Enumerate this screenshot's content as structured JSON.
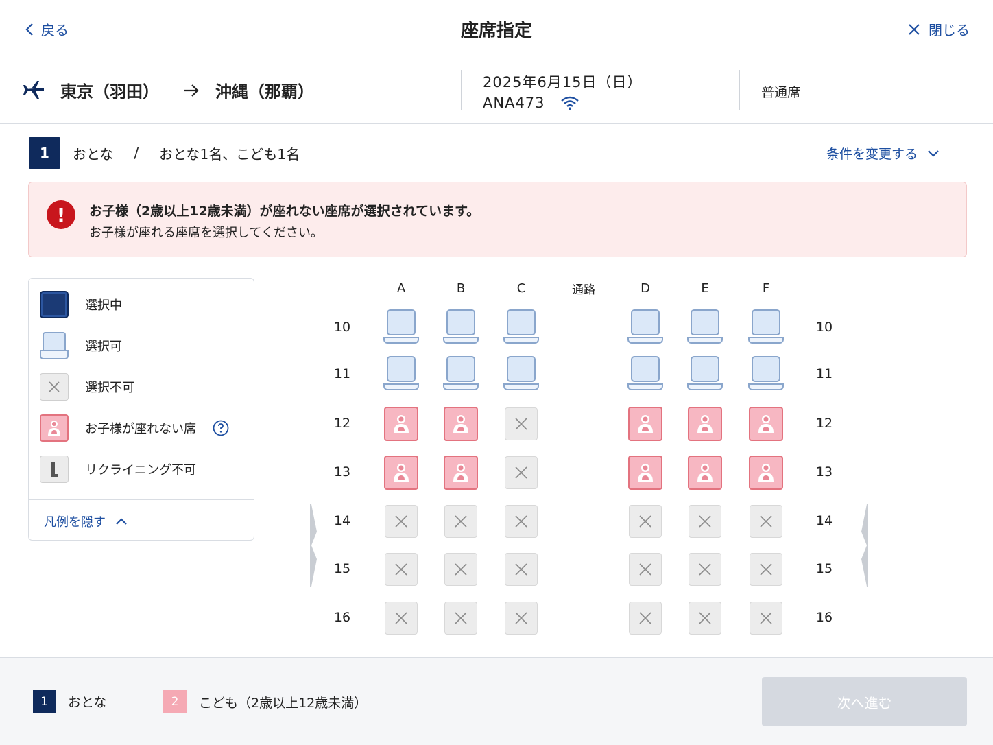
{
  "header": {
    "back_label": "戻る",
    "title": "座席指定",
    "close_label": "閉じる"
  },
  "flight": {
    "origin": "東京（羽田）",
    "destination": "沖縄（那覇）",
    "date": "2025年6月15日（日）",
    "flight_number": "ANA473",
    "wifi_icon": "wifi-icon",
    "cabin_class": "普通席"
  },
  "passenger_bar": {
    "active_number": "1",
    "active_label": "おとな",
    "separator": "/",
    "count_summary": "おとな1名、こども1名",
    "change_conditions_label": "条件を変更する"
  },
  "alert": {
    "line1": "お子様（2歳以上12歳未満）が座れない座席が選択されています。",
    "line2": "お子様が座れる座席を選択してください。",
    "color": "#c8161d"
  },
  "legend": {
    "items": [
      {
        "type": "selected",
        "label": "選択中"
      },
      {
        "type": "available",
        "label": "選択可"
      },
      {
        "type": "unavailable",
        "label": "選択不可"
      },
      {
        "type": "child-restricted",
        "label": "お子様が座れない席"
      },
      {
        "type": "no-recline",
        "label": "リクライニング不可"
      }
    ],
    "hide_label": "凡例を隠す"
  },
  "seatmap": {
    "columns": [
      "A",
      "B",
      "C",
      "D",
      "E",
      "F"
    ],
    "aisle_label": "通路",
    "rows": [
      {
        "row": "10",
        "seats": [
          "available",
          "available",
          "available",
          "available",
          "available",
          "available"
        ]
      },
      {
        "row": "11",
        "seats": [
          "available",
          "available",
          "available",
          "available",
          "available",
          "available"
        ]
      },
      {
        "row": "12",
        "seats": [
          "child-restricted",
          "child-restricted",
          "unavailable",
          "child-restricted",
          "child-restricted",
          "child-restricted"
        ]
      },
      {
        "row": "13",
        "seats": [
          "child-restricted",
          "child-restricted",
          "unavailable",
          "child-restricted",
          "child-restricted",
          "child-restricted"
        ]
      },
      {
        "row": "14",
        "seats": [
          "unavailable",
          "unavailable",
          "unavailable",
          "unavailable",
          "unavailable",
          "unavailable"
        ]
      },
      {
        "row": "15",
        "seats": [
          "unavailable",
          "unavailable",
          "unavailable",
          "unavailable",
          "unavailable",
          "unavailable"
        ]
      },
      {
        "row": "16",
        "seats": [
          "unavailable",
          "unavailable",
          "unavailable",
          "unavailable",
          "unavailable",
          "unavailable"
        ]
      }
    ]
  },
  "footer": {
    "passenger1_number": "1",
    "passenger1_label": "おとな",
    "passenger2_number": "2",
    "passenger2_label": "こども（2歳以上12歳未満）",
    "next_label": "次へ進む"
  },
  "colors": {
    "navy": "#0f2a5c",
    "link_blue": "#1e4fa1",
    "child_pink": "#f7b7c2",
    "alert_bg": "#fdecec"
  }
}
